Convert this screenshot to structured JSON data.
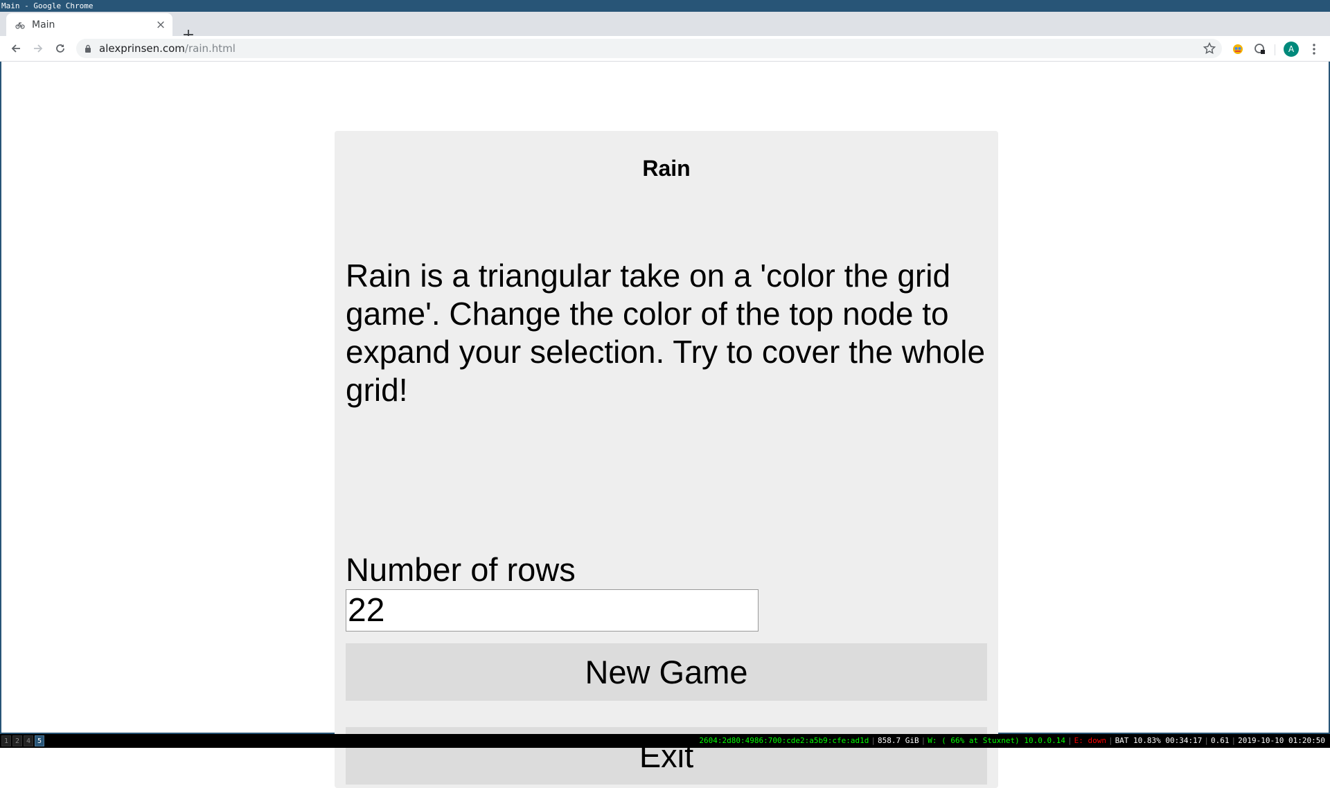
{
  "wm": {
    "title": "Main - Google Chrome"
  },
  "browser": {
    "tab_title": "Main",
    "url_host": "alexprinsen.com",
    "url_path": "/rain.html",
    "avatar_letter": "A"
  },
  "game": {
    "title": "Rain",
    "description": "Rain is a triangular take on a 'color the grid game'. Change the color of the top node to expand your selection. Try to cover the whole grid!",
    "rows_label": "Number of rows",
    "rows_value": "22",
    "new_game_label": "New Game",
    "exit_label": "Exit"
  },
  "statusbar": {
    "workspaces": [
      "1",
      "2",
      "4",
      "5"
    ],
    "active_workspace": "5",
    "ipv6": "2604:2d80:4986:700:cde2:a5b9:cfe:ad1d",
    "disk": "858.7 GiB",
    "wifi": "W: ( 66% at Stuxnet) 10.0.0.14",
    "ethernet": "E: down",
    "battery": "BAT 10.83% 00:34:17",
    "load": "0.61",
    "datetime": "2019-10-10 01:20:50"
  },
  "colors": {
    "wm_title_bg": "#285577",
    "tabstrip_bg": "#dee1e6",
    "panel_bg": "#eeeeee",
    "button_bg": "#dcdcdc",
    "status_green": "#00ff00",
    "status_red": "#ff0000",
    "avatar_bg": "#00897b"
  }
}
